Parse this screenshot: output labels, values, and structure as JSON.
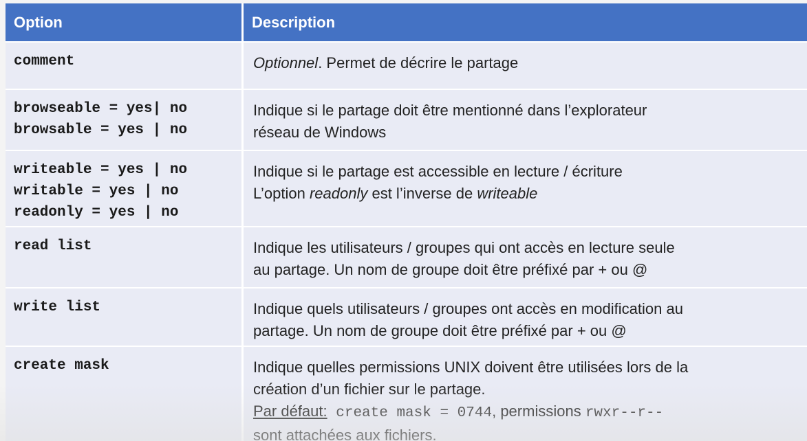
{
  "table": {
    "headers": {
      "option": "Option",
      "description": "Description"
    },
    "rows": [
      {
        "option_lines": [
          "comment"
        ],
        "desc": {
          "italic": "Optionnel",
          "rest": ". Permet de décrire le partage"
        }
      },
      {
        "option_lines": [
          "browseable = yes| no",
          "browsable = yes | no"
        ],
        "desc_lines": [
          "Indique si le partage doit être mentionné dans l’explorateur",
          "réseau de Windows"
        ]
      },
      {
        "option_lines": [
          "writeable = yes | no",
          "writable = yes | no",
          "readonly = yes | no"
        ],
        "desc": {
          "line1": "Indique si le partage est accessible en lecture / écriture",
          "line2_a": "L’option ",
          "line2_b": "readonly",
          "line2_c": " est l’inverse de ",
          "line2_d": "writeable"
        }
      },
      {
        "option_lines": [
          "read list"
        ],
        "desc_lines": [
          "Indique les utilisateurs / groupes qui ont accès en lecture seule",
          "au partage. Un nom de groupe doit être préfixé par + ou @"
        ]
      },
      {
        "option_lines": [
          "write list"
        ],
        "desc_lines": [
          "Indique quels utilisateurs / groupes ont accès en modification au",
          "partage. Un nom de groupe doit être préfixé par + ou @"
        ]
      },
      {
        "option_lines": [
          "create mask"
        ],
        "desc": {
          "line1": "Indique quelles permissions UNIX doivent être utilisées lors de la",
          "line2": "création d’un fichier sur le partage.",
          "default_label": "Par défaut:",
          "default_code": " create mask = 0744",
          "default_mid": ", permissions ",
          "perm_code": "rwxr--r--",
          "line4": "sont attachées aux fichiers."
        }
      }
    ]
  },
  "colors": {
    "header_bg": "#4472c4",
    "row_bg": "#e9ebf5",
    "header_text": "#ffffff"
  }
}
